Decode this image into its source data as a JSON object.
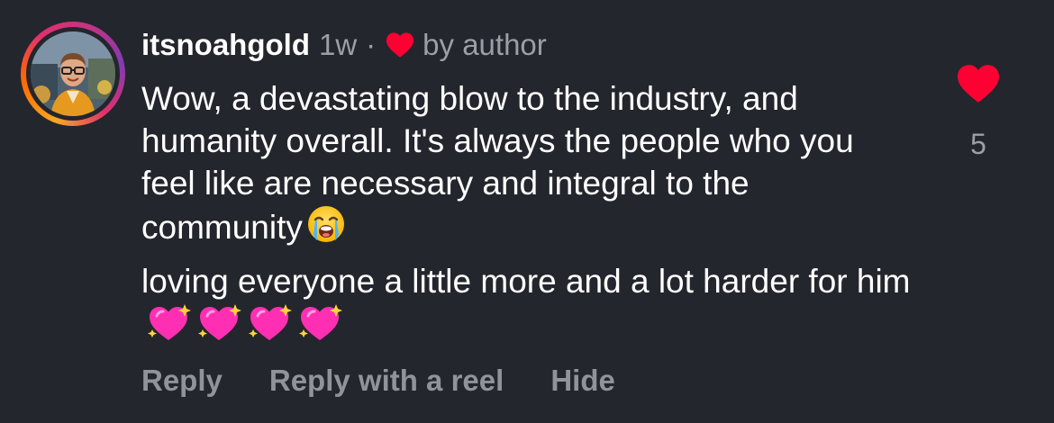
{
  "comment": {
    "username": "itsnoahgold",
    "time": "1w",
    "separator": "·",
    "liked_by_author_label": "by author",
    "paragraph1": "Wow, a devastating blow to the industry, and humanity overall. It's always the people who you feel like are necessary and integral to the community",
    "paragraph2": "loving everyone a little more and a lot harder for him",
    "paragraph1_emoji": "loudly-crying-face",
    "paragraph2_emoji": [
      "sparkling-heart",
      "sparkling-heart",
      "sparkling-heart",
      "sparkling-heart"
    ],
    "like_count": "5",
    "like_color": "#ff0033"
  },
  "actions": {
    "reply": "Reply",
    "reply_with_reel": "Reply with a reel",
    "hide": "Hide"
  }
}
